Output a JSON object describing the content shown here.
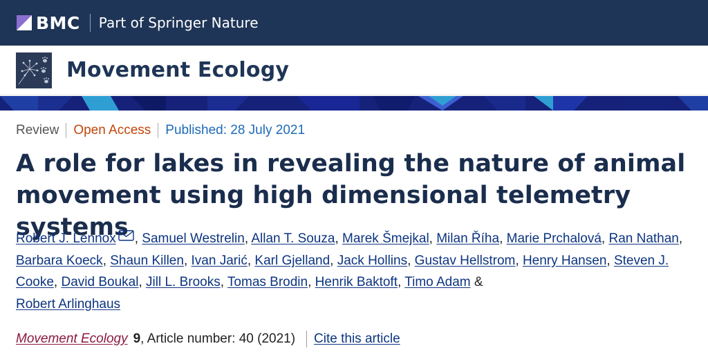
{
  "brand": {
    "publisher": "BMC",
    "tagline": "Part of Springer Nature"
  },
  "journal": {
    "name": "Movement Ecology"
  },
  "article": {
    "type": "Review",
    "access": "Open Access",
    "published": "Published: 28 July 2021",
    "title": "A role for lakes in revealing the nature of animal movement using high dimensional telemetry systems",
    "authors": [
      "Robert J. Lennox",
      "Samuel Westrelin",
      "Allan T. Souza",
      "Marek Šmejkal",
      "Milan Říha",
      "Marie Prchalová",
      "Ran Nathan",
      "Barbara Koeck",
      "Shaun Killen",
      "Ivan Jarić",
      "Karl Gjelland",
      "Jack Hollins",
      "Gustav Hellstrom",
      "Henry Hansen",
      "Steven J. Cooke",
      "David Boukal",
      "Jill L. Brooks",
      "Tomas Brodin",
      "Henrik Baktoft",
      "Timo Adam",
      "Robert Arlinghaus"
    ],
    "authors_conjunction": "&",
    "citation": {
      "journal": "Movement Ecology",
      "volume": "9",
      "article_number": ", Article number: 40 (2021)",
      "cite_link": "Cite this article"
    }
  },
  "colors": {
    "header_bg": "#1f3557",
    "banner_bg": "#16227a",
    "open_access": "#c0460b",
    "published": "#1d6bb8",
    "link": "#0c3480",
    "journal_cite": "#8b1a3e"
  },
  "icons": {
    "corresponding_author": "mail-icon"
  }
}
